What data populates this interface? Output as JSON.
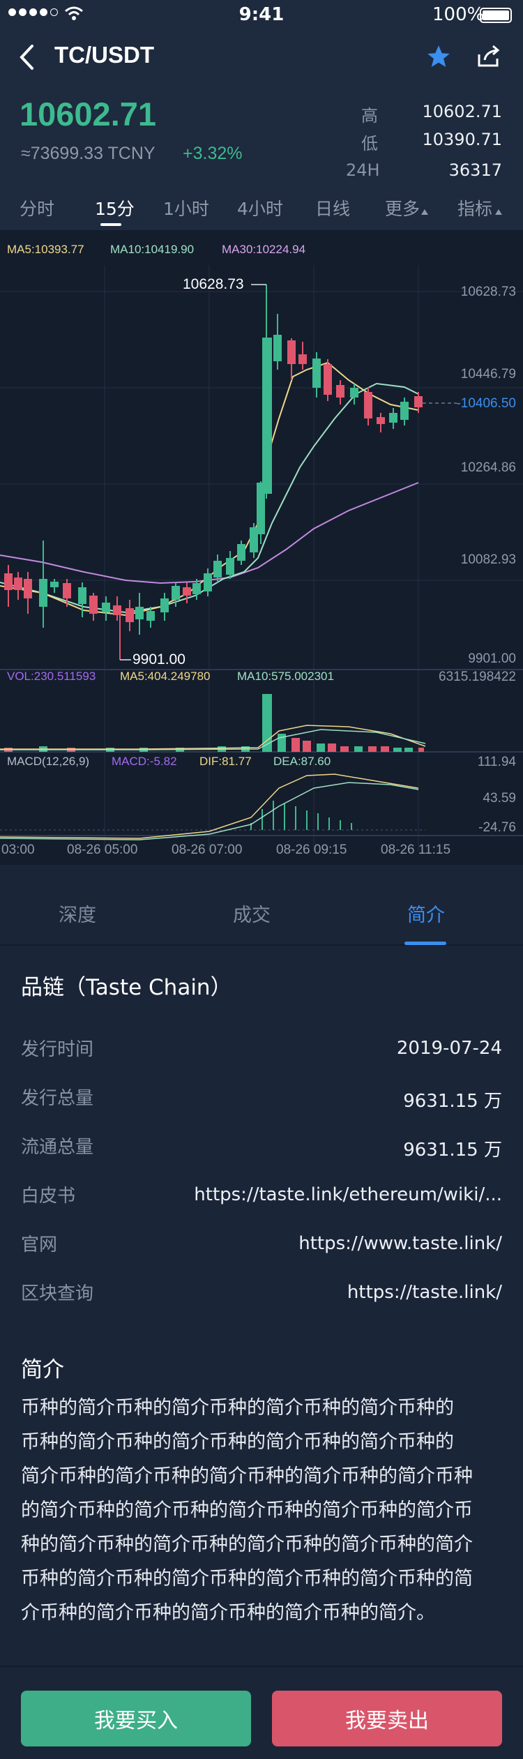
{
  "status": {
    "time": "9:41",
    "battery": "100%"
  },
  "header": {
    "pair": "TC/USDT",
    "price": "10602.71",
    "cny": "≈73699.33 TCNY",
    "change": "+3.32%",
    "high_label": "高",
    "high": "10602.71",
    "low_label": "低",
    "low": "10390.71",
    "vol_label": "24H",
    "vol": "36317"
  },
  "periods": [
    "分时",
    "15分",
    "1小时",
    "4小时",
    "日线",
    "更多",
    "指标"
  ],
  "ma": {
    "ma5": "MA5:10393.77",
    "ma10": "MA10:10419.90",
    "ma30": "MA30:10224.94"
  },
  "price_axis": [
    "10628.73",
    "10446.79",
    "10264.86",
    "10082.93",
    "9901.00"
  ],
  "current_price": "-10406.50",
  "hi_marker": "10628.73",
  "lo_marker": "9901.00",
  "volume": {
    "vol": "VOL:230.511593",
    "ma5": "MA5:404.249780",
    "ma10": "MA10:575.002301",
    "max": "6315.198422"
  },
  "macd": {
    "label": "MACD(12,26,9)",
    "macd": "MACD:-5.82",
    "dif": "DIF:81.77",
    "dea": "DEA:87.60",
    "axis": [
      "111.94",
      "43.59",
      "-24.76"
    ]
  },
  "time_axis": [
    "03:00",
    "08-26 05:00",
    "08-26 07:00",
    "08-26 09:15",
    "08-26 11:15"
  ],
  "info_tabs": [
    "深度",
    "成交",
    "简介"
  ],
  "token": {
    "name": "品链（Taste Chain）",
    "rows": [
      {
        "label": "发行时间",
        "value": "2019-07-24"
      },
      {
        "label": "发行总量",
        "value": "9631.15 万"
      },
      {
        "label": "流通总量",
        "value": "9631.15 万"
      },
      {
        "label": "白皮书",
        "value": "https://taste.link/ethereum/wiki/..."
      },
      {
        "label": "官网",
        "value": "https://www.taste.link/"
      },
      {
        "label": "区块查询",
        "value": "https://taste.link/"
      }
    ],
    "intro_title": "简介",
    "intro_lines": [
      "币种的简介币种的简介币种的简介币种的简介币种的",
      "币种的简介币种的简介币种的简介币种的简介币种的",
      "简介币种的简介币种的简介币种的简介币种的简介币种",
      "的简介币种的简介币种的简介币种的简介币种的简介币",
      "种的简介币种的简介币种的简介币种的简介币种的简介",
      "币种的简介币种的简介币种的简介币种的简介币种的简",
      "介币种的简介币种的简介币种的简介币种的简介。"
    ]
  },
  "buttons": {
    "buy": "我要买入",
    "sell": "我要卖出"
  },
  "colors": {
    "up": "#3dba8f",
    "down": "#e0566d",
    "accent": "#3a8ff0"
  }
}
